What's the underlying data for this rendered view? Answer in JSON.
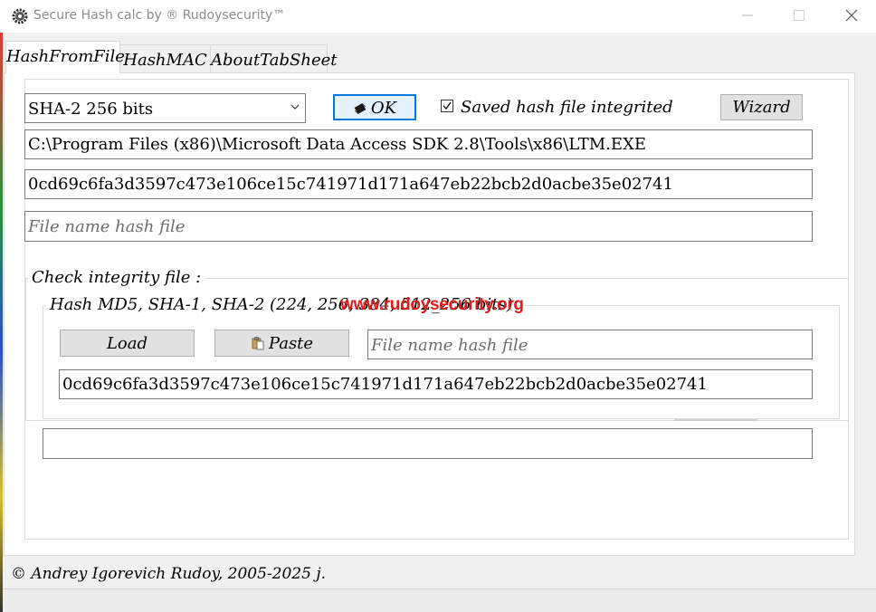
{
  "window": {
    "title": "Secure Hash calc by ® Rudoysecurity™"
  },
  "tabs": [
    {
      "label": "HashFromFile",
      "active": true
    },
    {
      "label": "HashMAC",
      "active": false
    },
    {
      "label": "AboutTabSheet",
      "active": false
    }
  ],
  "hash_from_file": {
    "algorithm_select": {
      "selected": "SHA-2 256 bits"
    },
    "ok_button": "OK",
    "saved_hash_checkbox": {
      "label": "Saved hash file integrited",
      "checked": true
    },
    "wizard_button": "Wizard",
    "file_path": "C:\\Program Files (x86)\\Microsoft Data Access SDK 2.8\\Tools\\x86\\LTM.EXE",
    "hash_value": "0cd69c6fa3d3597c473e106ce15c741971d171a647eb22bcb2d0acbe35e02741",
    "hash_file_name_placeholder": "File name hash file"
  },
  "check_integrity": {
    "group_title": "Check integrity file :",
    "subgroup_title": "Hash MD5, SHA-1, SHA-2 (224, 256, 384, 512_256 bits)",
    "watermark": "www.rudoysecurity.org",
    "load_button": "Load",
    "paste_button": "Paste",
    "hash_file_name_placeholder": "File name hash file",
    "hash_value": "0cd69c6fa3d3597c473e106ce15c741971d171a647eb22bcb2d0acbe35e02741",
    "result_text": ""
  },
  "footer": {
    "copyright": "© Andrey Igorevich Rudoy, 2005-2025 j."
  },
  "colors": {
    "accent": "#0078d7",
    "watermark": "#e01b1b"
  }
}
